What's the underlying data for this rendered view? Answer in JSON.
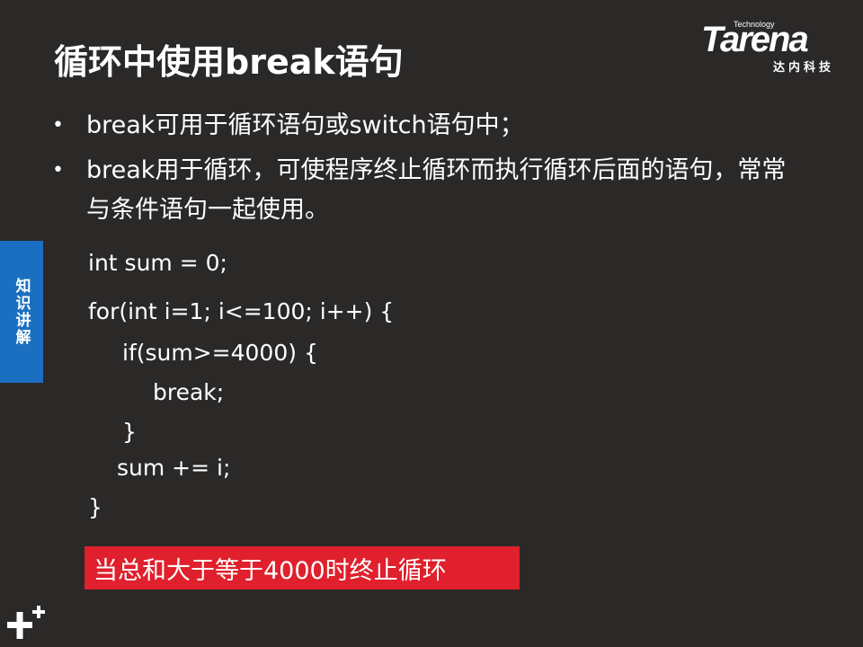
{
  "header": {
    "title": "循环中使用break语句"
  },
  "logo": {
    "tagline": "Technology",
    "brand": "Tarena",
    "subtitle": "达内科技"
  },
  "side_tab": {
    "label": "知识讲解"
  },
  "bullets": [
    "break可用于循环语句或switch语句中；",
    "break用于循环，可使程序终止循环而执行循环后面的语句，常常与条件语句一起使用。"
  ],
  "code": [
    "int sum = 0;",
    "for(int i=1; i<=100; i++) {",
    "if(sum>=4000) {",
    "break;",
    "}",
    "sum += i;",
    "}"
  ],
  "callout": {
    "text": "当总和大于等于4000时终止循环"
  },
  "colors": {
    "background": "#2b2828",
    "side_tab": "#1a6fc0",
    "callout": "#e0202c",
    "text": "#ffffff"
  }
}
